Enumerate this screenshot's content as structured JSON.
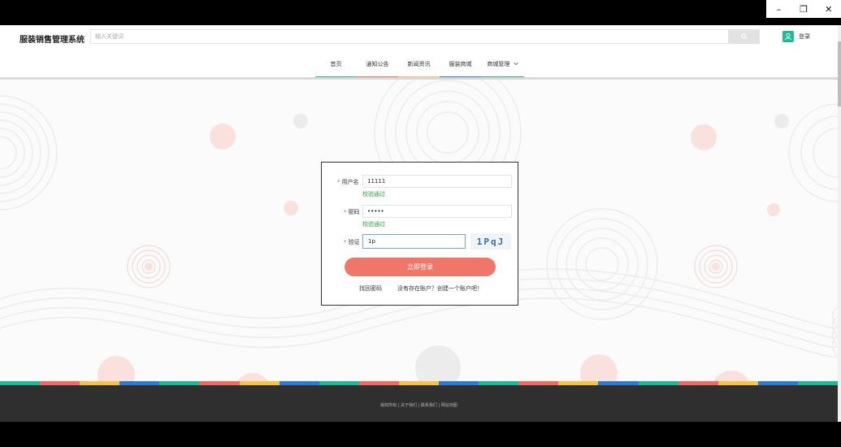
{
  "window": {
    "minimize_glyph": "–",
    "maximize_glyph": "❐",
    "close_glyph": "✕"
  },
  "header": {
    "site_title": "服装销售管理系统",
    "search_placeholder": "输入关键词",
    "search_icon": "search-icon",
    "login_label": "登录",
    "user_icon": "user-icon"
  },
  "nav": {
    "items": [
      {
        "label": "首页",
        "color": "#1fb997"
      },
      {
        "label": "通知公告",
        "color": "#ee6b61"
      },
      {
        "label": "新闻资讯",
        "color": "#f5c24c"
      },
      {
        "label": "服装商城",
        "color": "#2d7bd1"
      },
      {
        "label": "商城管理",
        "color": "#1fb997"
      }
    ],
    "dropdown_icon": "chevron-down-icon"
  },
  "login": {
    "username_label": "用户名",
    "username_value": "11111",
    "username_hint": "校验通过",
    "password_label": "密码",
    "password_value": "•••••",
    "password_hint": "校验通过",
    "captcha_label": "验证",
    "captcha_value": "1p",
    "captcha_text": "1PqJ",
    "submit_label": "立即登录",
    "forgot_label": "找回密码",
    "register_label": "没有存在账户？创建一个账户吧！"
  },
  "footer": {
    "links_text": "版权所有 | 关于我们 | 联系我们 | 网站地图"
  },
  "colors": {
    "accent": "#ef7669",
    "green": "#1fb997",
    "yellow": "#f5c24c",
    "blue": "#2d7bd1",
    "red": "#ee6b61"
  }
}
